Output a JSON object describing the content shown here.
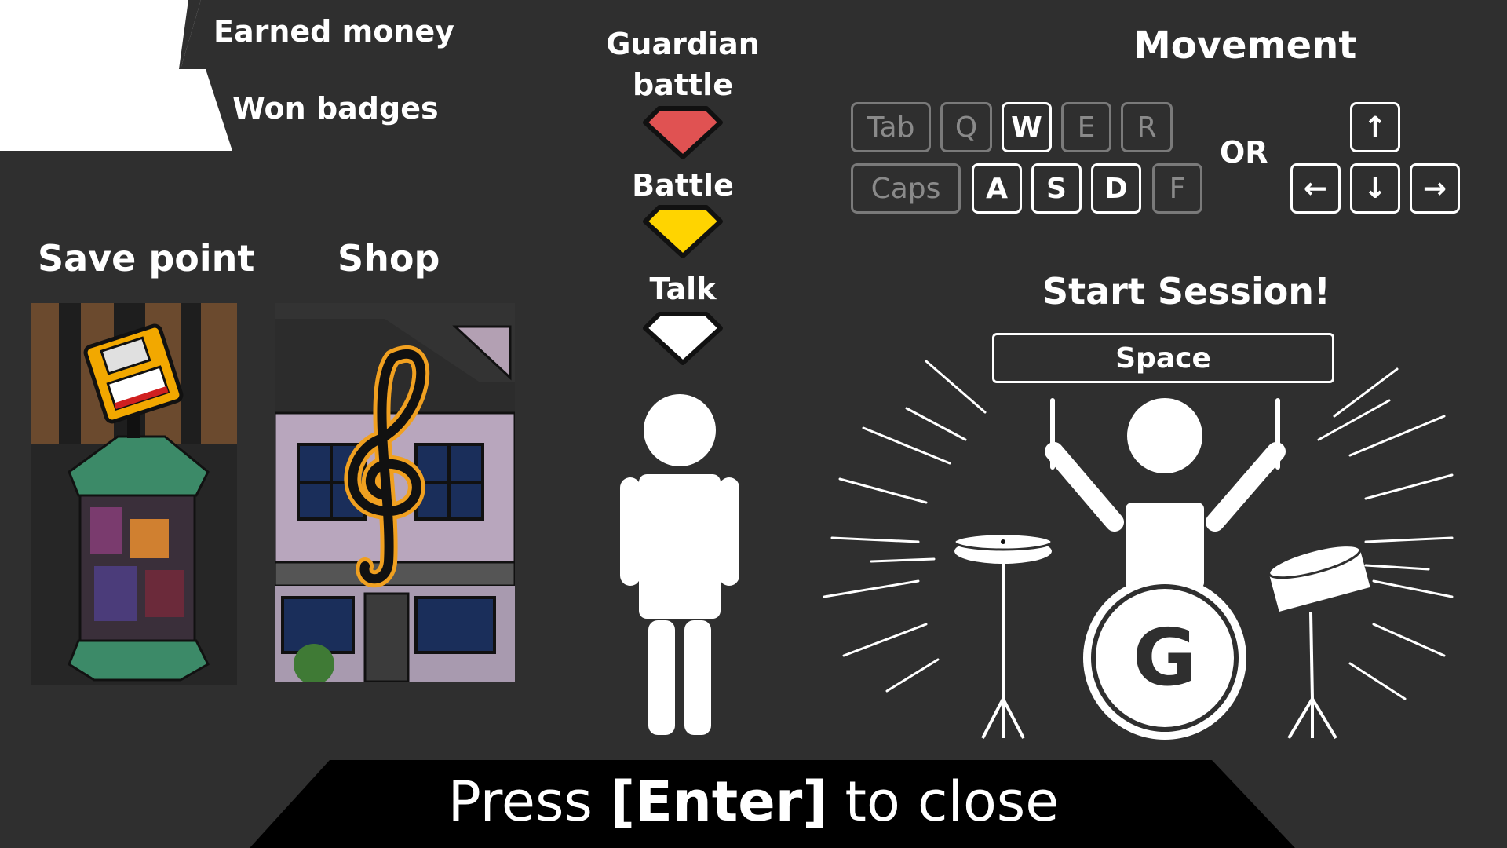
{
  "hud": {
    "earned_money": "Earned money",
    "won_badges": "Won badges"
  },
  "legend": {
    "guardian_battle_line1": "Guardian",
    "guardian_battle_line2": "battle",
    "battle": "Battle",
    "talk": "Talk",
    "colors": {
      "guardian": "#e05252",
      "battle": "#ffd400",
      "talk": "#ffffff"
    }
  },
  "locations": {
    "save_point": "Save point",
    "shop": "Shop"
  },
  "movement": {
    "title": "Movement",
    "or": "OR",
    "keys_row1": [
      {
        "label": "Tab",
        "active": false
      },
      {
        "label": "Q",
        "active": false
      },
      {
        "label": "W",
        "active": true
      },
      {
        "label": "E",
        "active": false
      },
      {
        "label": "R",
        "active": false
      }
    ],
    "keys_row2": [
      {
        "label": "Caps",
        "active": false
      },
      {
        "label": "A",
        "active": true
      },
      {
        "label": "S",
        "active": true
      },
      {
        "label": "D",
        "active": true
      },
      {
        "label": "F",
        "active": false
      }
    ],
    "arrows": {
      "up": "↑",
      "left": "←",
      "down": "↓",
      "right": "→"
    }
  },
  "session": {
    "title": "Start Session!",
    "key": "Space",
    "drum_letter": "G"
  },
  "footer": {
    "prefix": "Press ",
    "key": "[Enter]",
    "suffix": " to close"
  }
}
